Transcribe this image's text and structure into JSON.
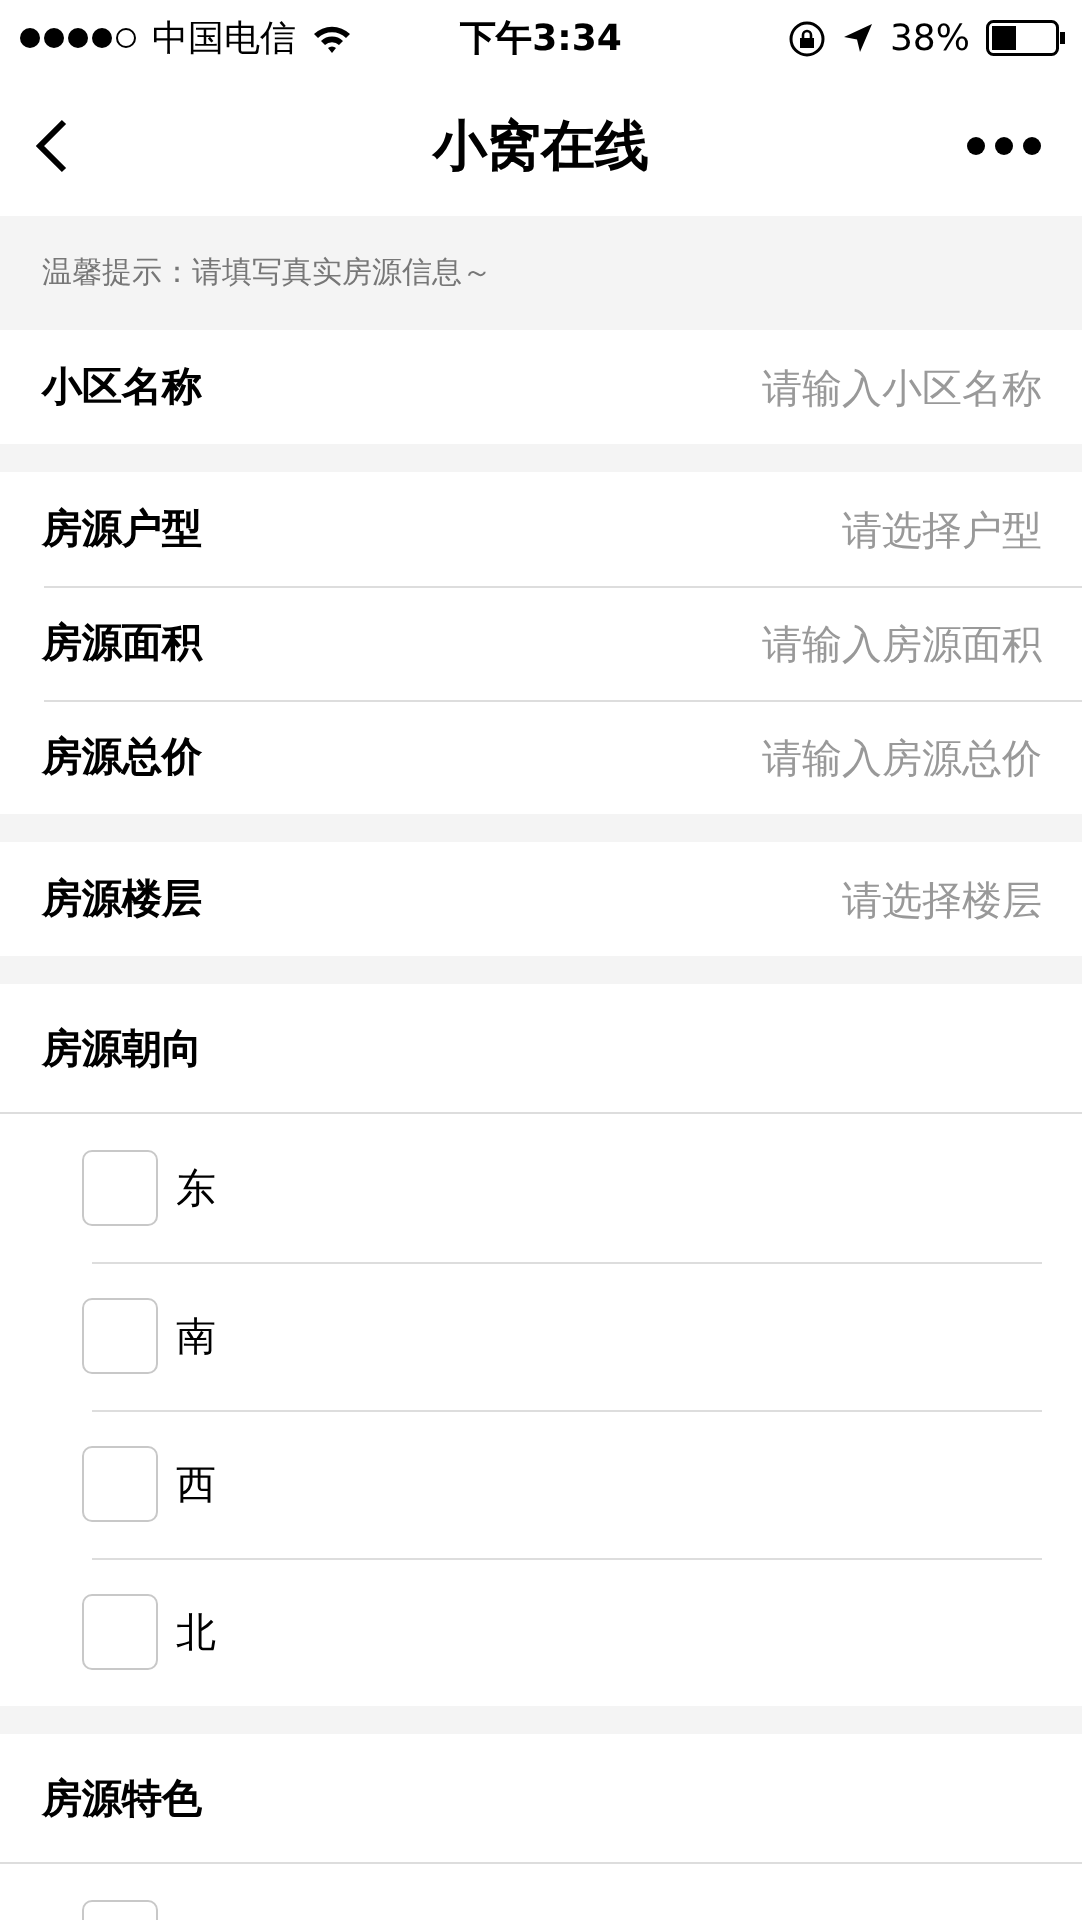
{
  "status_bar": {
    "carrier": "中国电信",
    "time": "下午3:34",
    "battery": "38%"
  },
  "nav": {
    "title": "小窝在线"
  },
  "tip": "温馨提示：请填写真实房源信息～",
  "groups": [
    [
      {
        "label": "小区名称",
        "placeholder": "请输入小区名称"
      }
    ],
    [
      {
        "label": "房源户型",
        "placeholder": "请选择户型"
      },
      {
        "label": "房源面积",
        "placeholder": "请输入房源面积"
      },
      {
        "label": "房源总价",
        "placeholder": "请输入房源总价"
      }
    ],
    [
      {
        "label": "房源楼层",
        "placeholder": "请选择楼层"
      }
    ]
  ],
  "checklists": [
    {
      "title": "房源朝向",
      "options": [
        {
          "label": "东",
          "checked": false
        },
        {
          "label": "南",
          "checked": false
        },
        {
          "label": "西",
          "checked": false
        },
        {
          "label": "北",
          "checked": false
        }
      ]
    },
    {
      "title": "房源特色",
      "options": [
        {
          "checked": false
        }
      ]
    }
  ]
}
